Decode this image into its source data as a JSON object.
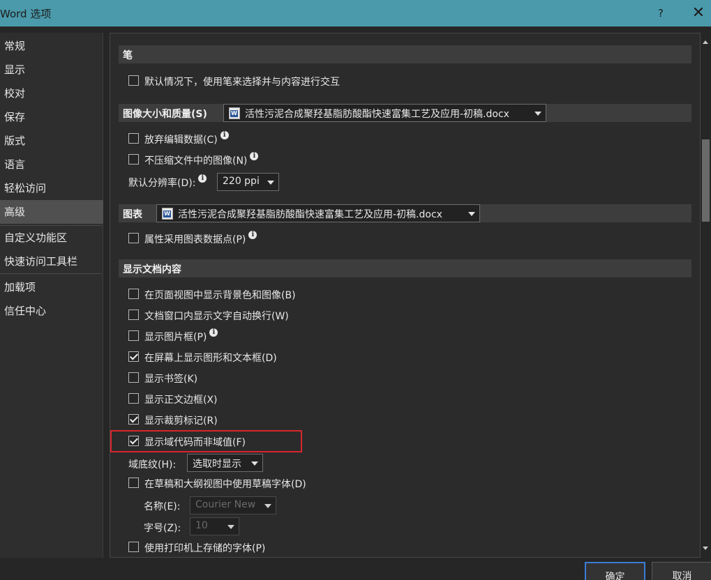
{
  "window": {
    "title": "Word 选项",
    "help": "?",
    "close": "✕"
  },
  "sidebar": {
    "items": [
      {
        "label": "常规"
      },
      {
        "label": "显示"
      },
      {
        "label": "校对"
      },
      {
        "label": "保存"
      },
      {
        "label": "版式"
      },
      {
        "label": "语言"
      },
      {
        "label": "轻松访问"
      },
      {
        "label": "高级"
      },
      {
        "label": "自定义功能区"
      },
      {
        "label": "快速访问工具栏"
      },
      {
        "label": "加载项"
      },
      {
        "label": "信任中心"
      }
    ],
    "selected": "高级"
  },
  "pen": {
    "header": "笔",
    "use_pen": {
      "label": "默认情况下，使用笔来选择并与内容进行交互",
      "checked": false
    }
  },
  "image": {
    "header": "图像大小和质量(S)",
    "file": "活性污泥合成聚羟基脂肪酸酯快速富集工艺及应用-初稿.docx",
    "discard_edit": {
      "label": "放弃编辑数据(C)",
      "checked": false
    },
    "no_compress": {
      "label": "不压缩文件中的图像(N)",
      "checked": false
    },
    "resolution_label": "默认分辨率(D):",
    "resolution_value": "220 ppi"
  },
  "chart": {
    "header": "图表",
    "file": "活性污泥合成聚羟基脂肪酸酯快速富集工艺及应用-初稿.docx",
    "properties_follow": {
      "label": "属性采用图表数据点(P)",
      "checked": false
    }
  },
  "display": {
    "header": "显示文档内容",
    "bg_colors": {
      "label": "在页面视图中显示背景色和图像(B)",
      "checked": false
    },
    "wrap": {
      "label": "文档窗口内显示文字自动换行(W)",
      "checked": false
    },
    "picture_placeholders": {
      "label": "显示图片框(P)",
      "checked": false
    },
    "drawings": {
      "label": "在屏幕上显示图形和文本框(D)",
      "checked": true
    },
    "bookmarks": {
      "label": "显示书签(K)",
      "checked": false
    },
    "text_boundaries": {
      "label": "显示正文边框(X)",
      "checked": false
    },
    "crop_marks": {
      "label": "显示裁剪标记(R)",
      "checked": true
    },
    "field_codes": {
      "label": "显示域代码而非域值(F)",
      "checked": true
    },
    "field_shading_label": "域底纹(H):",
    "field_shading_value": "选取时显示",
    "draft_font": {
      "label": "在草稿和大纲视图中使用草稿字体(D)",
      "checked": false
    },
    "font_name_label": "名称(E):",
    "font_name_value": "Courier New",
    "font_size_label": "字号(Z):",
    "font_size_value": "10",
    "printer_fonts": {
      "label": "使用打印机上存储的字体(P)",
      "checked": false
    }
  },
  "icons": {
    "info": "i",
    "doc": "W"
  },
  "footer": {
    "ok": "确定",
    "cancel": "取消"
  },
  "colors": {
    "titlebar": "#4a9aab",
    "highlight": "#d9262b",
    "primary_border": "#3a7dd6"
  }
}
